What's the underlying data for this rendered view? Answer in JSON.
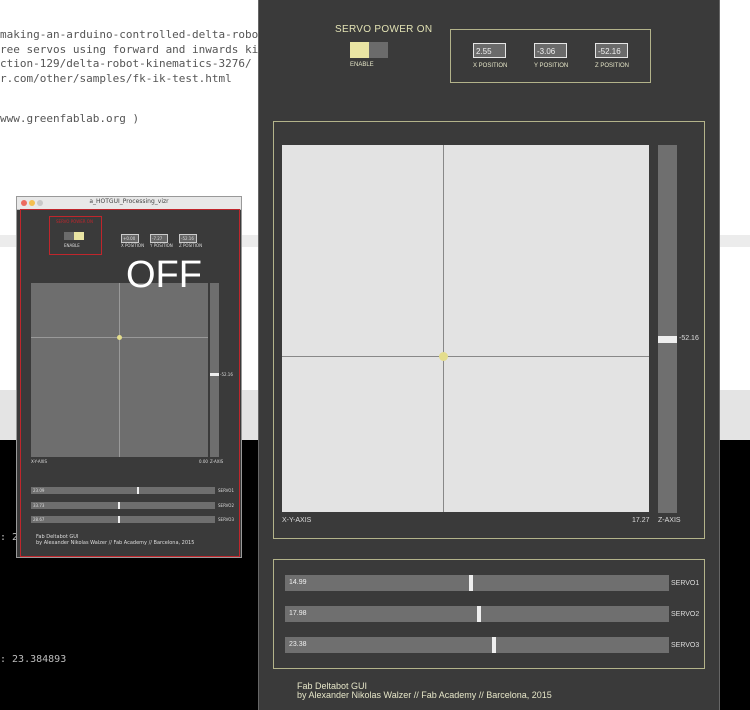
{
  "editor": {
    "lines": [
      "making-an-arduino-controlled-delta-robot/",
      "ree servos using forward and inwards kinem",
      "ction-129/delta-robot-kinematics-3276/",
      "r.com/other/samples/fk-ik-test.html",
      "www.greenfablab.org )"
    ]
  },
  "console": {
    "lines": [
      ": 2",
      ": 23.384893"
    ]
  },
  "small_window": {
    "title": "a_HOTGUI_Processing_vizr",
    "servo_power_label": "SERVO POWER ON",
    "enable_label": "ENABLE",
    "x_value": "+0.00",
    "y_value": "-7.27",
    "z_value": "-52.16",
    "x_label": "X POSITION",
    "y_label": "Y POSITION",
    "z_label": "Z POSITION",
    "xy_axis_label": "X-Y-AXIS",
    "xy_value": "0.00",
    "z_axis_label": "Z-AXIS",
    "z_slider_value": "-52.16",
    "servos": [
      {
        "value": "23.09",
        "name": "SERVO1",
        "level": 0.55
      },
      {
        "value": "33.73",
        "name": "SERVO2",
        "level": 0.45
      },
      {
        "value": "28.67",
        "name": "SERVO3",
        "level": 0.45
      }
    ],
    "credit_title": "Fab Deltabot GUI",
    "credit_sub": "by Alexander Nikolas Walzer // Fab Academy // Barcelona, 2015",
    "status_overlay": "OFF"
  },
  "main_window": {
    "servo_power_label": "SERVO POWER ON",
    "enable_label": "ENABLE",
    "position": {
      "x": {
        "value": "2.55",
        "label": "X POSITION"
      },
      "y": {
        "value": "-3.06",
        "label": "Y POSITION"
      },
      "z": {
        "value": "-52.16",
        "label": "Z POSITION"
      }
    },
    "xy_axis_label": "X-Y-AXIS",
    "xy_value": "17.27",
    "z_axis_label": "Z-AXIS",
    "z_slider_value": "-52.16",
    "servos": [
      {
        "value": "14.99",
        "name": "SERVO1",
        "level": 0.48
      },
      {
        "value": "17.98",
        "name": "SERVO2",
        "level": 0.5
      },
      {
        "value": "23.38",
        "name": "SERVO3",
        "level": 0.54
      }
    ],
    "credit_title": "Fab Deltabot GUI",
    "credit_sub": "by Alexander Nikolas Walzer // Fab Academy // Barcelona, 2015"
  },
  "colors": {
    "accent_yellow": "#e9e4a3",
    "panel_border": "#b3b38a",
    "window_bg": "#3a3a3a",
    "small_border": "#c0262c"
  }
}
